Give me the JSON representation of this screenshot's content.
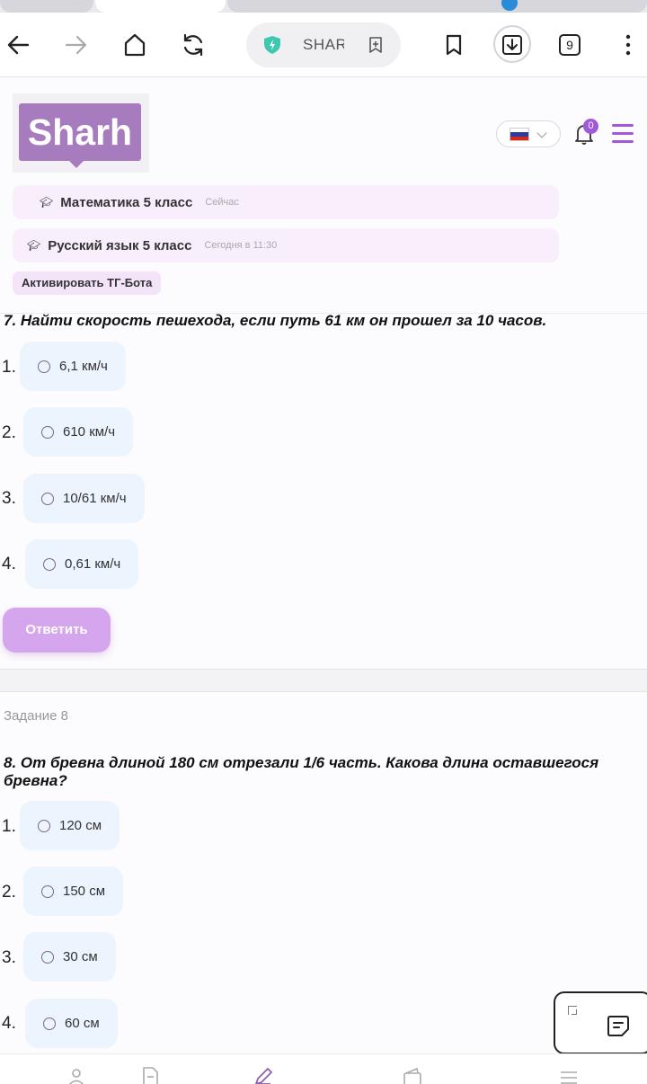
{
  "browser": {
    "url_text": "SHAR",
    "tab_count": "9"
  },
  "site": {
    "logo_text": "Sharh",
    "notification_count": "0",
    "notifications": [
      {
        "name": "Математика 5 класс",
        "time": "Сейчас"
      },
      {
        "name": "Русский язык 5 класс",
        "time": "Сегодня в 11:30"
      }
    ],
    "tg_button": "Активировать ТГ-Бота"
  },
  "question7": {
    "text": "7. Найти скорость пешехода, если путь 61 км он прошел за 10 часов.",
    "answers": [
      {
        "num": "1.",
        "text": "6,1 км/ч"
      },
      {
        "num": "2.",
        "text": "610 км/ч"
      },
      {
        "num": "3.",
        "text": "10/61 км/ч"
      },
      {
        "num": "4.",
        "text": "0,61 км/ч"
      }
    ],
    "submit": "Ответить"
  },
  "task8": {
    "label": "Задание 8",
    "text": "8. От бревна длиной 180 см отрезали 1/6 часть. Какова длина оставшегося бревна?",
    "answers": [
      {
        "num": "1.",
        "text": "120 см"
      },
      {
        "num": "2.",
        "text": "150 см"
      },
      {
        "num": "3.",
        "text": "30 см"
      },
      {
        "num": "4.",
        "text": "60 см"
      }
    ]
  },
  "colors": {
    "accent": "#a259d9",
    "logo": "#a77cbf",
    "answer_bg": "#ecf4fd",
    "submit_bg": "#d5a6ee"
  },
  "icons": [
    "back-icon",
    "forward-icon",
    "home-icon",
    "reload-icon",
    "shield-icon",
    "add-bookmark-icon",
    "bookmark-icon",
    "download-icon",
    "more-icon",
    "bell-icon",
    "menu-icon",
    "graduation-cap-icon",
    "chat-icon",
    "expand-icon",
    "profile-icon",
    "document-icon",
    "pencil-icon",
    "wallet-icon",
    "list-icon"
  ]
}
